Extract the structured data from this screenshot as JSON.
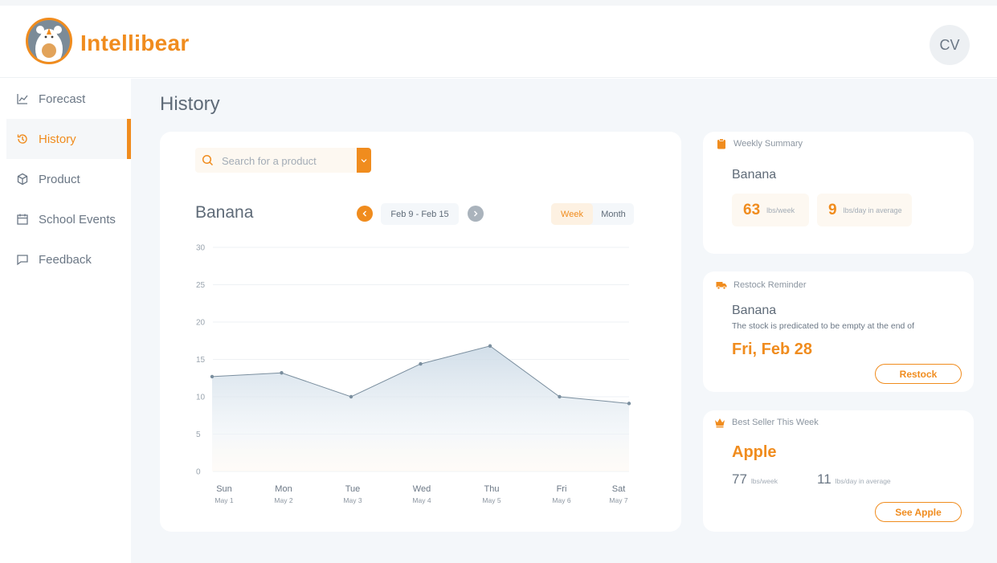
{
  "app": {
    "brand": "Intellibear",
    "user_initials": "CV"
  },
  "colors": {
    "accent": "#f08c1e",
    "line": "#7a8e9e",
    "text": "#5f6b78"
  },
  "sidebar": {
    "items": [
      {
        "label": "Forecast",
        "icon": "line-chart-icon",
        "active": false
      },
      {
        "label": "History",
        "icon": "history-icon",
        "active": true
      },
      {
        "label": "Product",
        "icon": "cube-icon",
        "active": false
      },
      {
        "label": "School Events",
        "icon": "calendar-icon",
        "active": false
      },
      {
        "label": "Feedback",
        "icon": "message-icon",
        "active": false
      }
    ]
  },
  "page": {
    "title": "History"
  },
  "search": {
    "placeholder": "Search for a product"
  },
  "chart_panel": {
    "product": "Banana",
    "date_range": "Feb 9 - Feb 15",
    "toggle": {
      "week": "Week",
      "month": "Month",
      "selected": "Week"
    }
  },
  "chart_data": {
    "type": "area",
    "categories": [
      "Sun",
      "Mon",
      "Tue",
      "Wed",
      "Thu",
      "Fri",
      "Sat"
    ],
    "sub_labels": [
      "May 1",
      "May 2",
      "May 3",
      "May 4",
      "May 5",
      "May 6",
      "May 7"
    ],
    "values": [
      12.7,
      13.2,
      10.0,
      14.4,
      16.8,
      10.0,
      9.1
    ],
    "ylim": [
      0,
      30
    ],
    "yticks": [
      0,
      5,
      10,
      15,
      20,
      25,
      30
    ],
    "grid": true,
    "title": "",
    "xlabel": "",
    "ylabel": ""
  },
  "weekly_summary": {
    "header": "Weekly Summary",
    "product": "Banana",
    "weekly_value": "63",
    "weekly_unit": "lbs/week",
    "daily_value": "9",
    "daily_unit": "lbs/day in average"
  },
  "restock": {
    "header": "Restock Reminder",
    "product": "Banana",
    "description": "The stock is predicated to be empty at the end of",
    "date": "Fri, Feb 28",
    "button": "Restock"
  },
  "best_seller": {
    "header": "Best Seller This Week",
    "product": "Apple",
    "weekly_value": "77",
    "weekly_unit": "lbs/week",
    "daily_value": "11",
    "daily_unit": "lbs/day in average",
    "button": "See Apple"
  }
}
